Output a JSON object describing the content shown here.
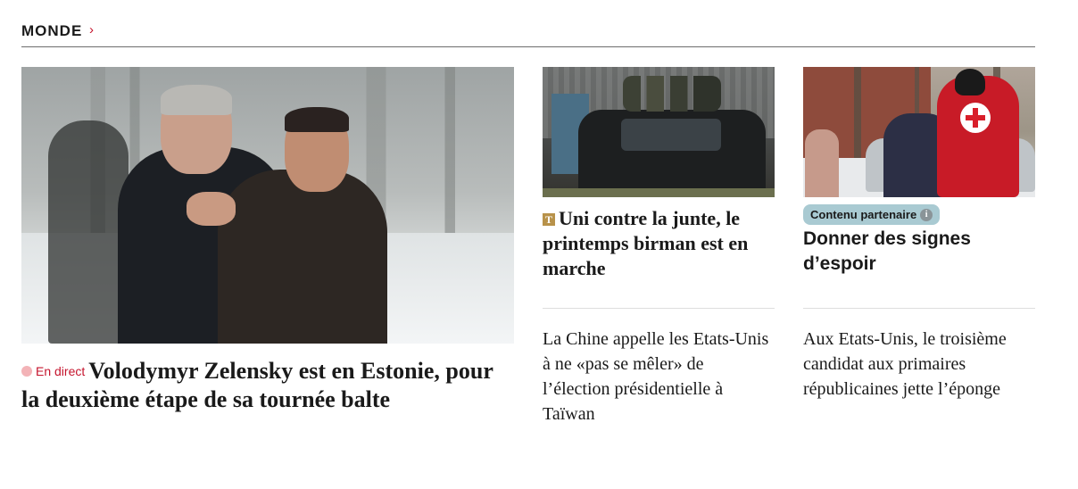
{
  "section": {
    "title": "MONDE",
    "chevron": "›",
    "colors": {
      "accent": "#c5142d",
      "divider": "#6d6d6d"
    }
  },
  "main_article": {
    "live_label": "En direct",
    "headline": "Volodymyr Zelensky est en Estonie, pour la deuxième étape de sa tournée balte",
    "image": "photo-zelensky-estonia-embrace"
  },
  "mid_article": {
    "premium_icon": "T",
    "headline": "Uni contre la junte, le printemps birman est en marche",
    "image": "photo-myanmar-fighters-truck"
  },
  "right_article": {
    "partner_badge": "Contenu partenaire",
    "info_icon": "i",
    "headline": "Donner des signes d’espoir",
    "image": "photo-red-cross-worker"
  },
  "secondary_mid": {
    "headline": "La Chine appelle les Etats-Unis à ne «pas se mêler» de l’élection présidentielle à Taïwan"
  },
  "secondary_right": {
    "headline": "Aux Etats-Unis, le troisième candidat aux primaires républicaines jette l’éponge"
  }
}
